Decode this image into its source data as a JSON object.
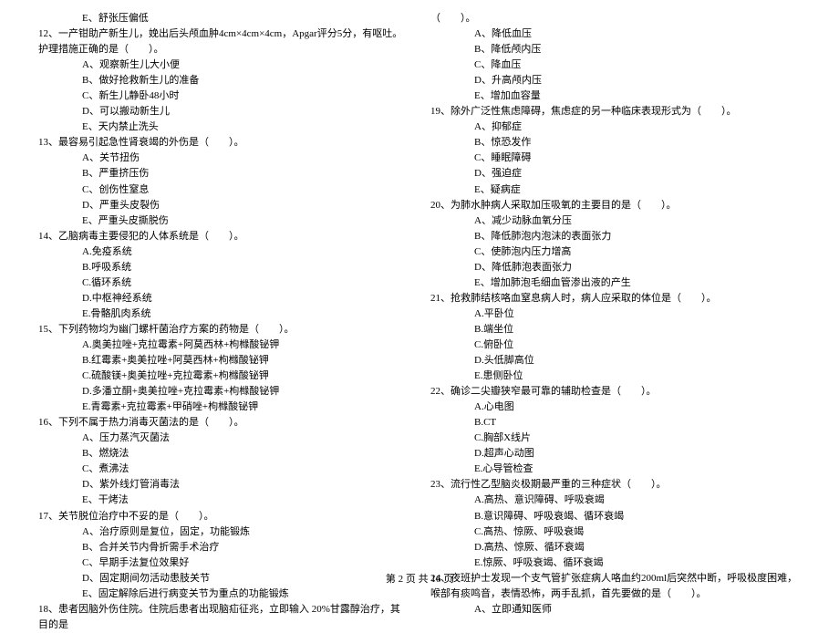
{
  "left": {
    "q11_e": "E、舒张压偏低",
    "q12_stem": "12、一产钳助产新生儿，娩出后头颅血肿4cm×4cm×4cm，Apgar评分5分，有呕吐。护理措施正确的是（　　）。",
    "q12_a": "A、观察新生儿大小便",
    "q12_b": "B、做好抢救新生儿的准备",
    "q12_c": "C、新生儿静卧48小时",
    "q12_d": "D、可以搬动新生儿",
    "q12_e": "E、天内禁止洗头",
    "q13_stem": "13、最容易引起急性肾衰竭的外伤是（　　）。",
    "q13_a": "A、关节扭伤",
    "q13_b": "B、严重挤压伤",
    "q13_c": "C、创伤性窒息",
    "q13_d": "D、严重头皮裂伤",
    "q13_e": "E、严重头皮撕脱伤",
    "q14_stem": "14、乙脑病毒主要侵犯的人体系统是（　　）。",
    "q14_a": "A.免疫系统",
    "q14_b": "B.呼吸系统",
    "q14_c": "C.循环系统",
    "q14_d": "D.中枢神经系统",
    "q14_e": "E.骨骼肌肉系统",
    "q15_stem": "15、下列药物均为幽门螺杆菌治疗方案的药物是（　　）。",
    "q15_a": "A.奥美拉唑+克拉霉素+阿莫西林+枸橼酸铋钾",
    "q15_b": "B.红霉素+奥美拉唑+阿莫西林+枸橼酸铋钾",
    "q15_c": "C.硫酸镁+奥美拉唑+克拉霉素+枸橼酸铋钾",
    "q15_d": "D.多潘立酮+奥美拉唑+克拉霉素+枸橼酸铋钾",
    "q15_e": "E.青霉素+克拉霉素+甲硝唑+枸橼酸铋钾",
    "q16_stem": "16、下列不属于热力消毒灭菌法的是（　　）。",
    "q16_a": "A、压力蒸汽灭菌法",
    "q16_b": "B、燃烧法",
    "q16_c": "C、煮沸法",
    "q16_d": "D、紫外线灯管消毒法",
    "q16_e": "E、干烤法",
    "q17_stem": "17、关节脱位治疗中不妥的是（　　）。",
    "q17_a": "A、治疗原则是复位，固定，功能锻炼",
    "q17_b": "B、合并关节内骨折需手术治疗",
    "q17_c": "C、早期手法复位效果好",
    "q17_d": "D、固定期间勿活动患肢关节",
    "q17_e": "E、固定解除后进行病变关节为重点的功能锻炼",
    "q18_stem": "18、患者因脑外伤住院。住院后患者出现脑疝征兆，立即输入 20%甘露醇治疗，其目的是"
  },
  "right": {
    "q18_cont": "（　　）。",
    "q18_a": "A、降低血压",
    "q18_b": "B、降低颅内压",
    "q18_c": "C、降血压",
    "q18_d": "D、升高颅内压",
    "q18_e": "E、增加血容量",
    "q19_stem": "19、除外广泛性焦虑障碍，焦虑症的另一种临床表现形式为（　　）。",
    "q19_a": "A、抑郁症",
    "q19_b": "B、惊恐发作",
    "q19_c": "C、睡眠障碍",
    "q19_d": "D、强迫症",
    "q19_e": "E、疑病症",
    "q20_stem": "20、为肺水肿病人采取加压吸氧的主要目的是（　　）。",
    "q20_a": "A、减少动脉血氧分压",
    "q20_b": "B、降低肺泡内泡沫的表面张力",
    "q20_c": "C、使肺泡内压力增高",
    "q20_d": "D、降低肺泡表面张力",
    "q20_e": "E、增加肺泡毛细血管渗出液的产生",
    "q21_stem": "21、抢救肺结核咯血窒息病人时，病人应采取的体位是（　　）。",
    "q21_a": "A.平卧位",
    "q21_b": "B.端坐位",
    "q21_c": "C.俯卧位",
    "q21_d": "D.头低脚高位",
    "q21_e": "E.患侧卧位",
    "q22_stem": "22、确诊二尖瓣狭窄最可靠的辅助检查是（　　）。",
    "q22_a": "A.心电图",
    "q22_b": "B.CT",
    "q22_c": "C.胸部X线片",
    "q22_d": "D.超声心动图",
    "q22_e": "E.心导管检查",
    "q23_stem": "23、流行性乙型脑炎极期最严重的三种症状（　　）。",
    "q23_a": "A.高热、意识障碍、呼吸衰竭",
    "q23_b": "B.意识障碍、呼吸衰竭、循环衰竭",
    "q23_c": "C.高热、惊厥、呼吸衰竭",
    "q23_d": "D.高热、惊厥、循环衰竭",
    "q23_e": "E.惊厥、呼吸衰竭、循环衰竭",
    "q24_stem": "24、夜班护士发现一个支气管扩张症病人咯血约200ml后突然中断，呼吸极度困难，喉部有痰鸣音，表情恐怖，两手乱抓，首先要做的是（　　）。",
    "q24_a": "A、立即通知医师"
  },
  "footer": "第 2 页 共 16 页"
}
